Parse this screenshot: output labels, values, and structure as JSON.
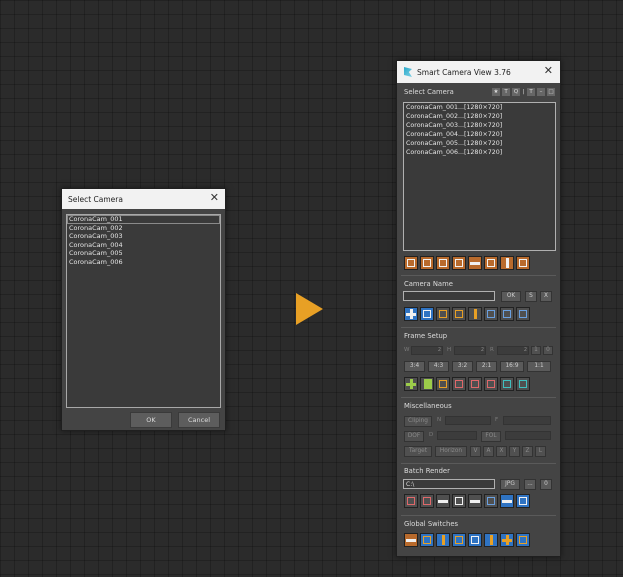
{
  "dialog": {
    "title": "Select Camera",
    "items": [
      "CoronaCam_001",
      "CoronaCam_002",
      "CoronaCam_003",
      "CoronaCam_004",
      "CoronaCam_005",
      "CoronaCam_006"
    ],
    "ok_label": "OK",
    "cancel_label": "Cancel"
  },
  "arrow_color": "#e8a025",
  "panel": {
    "title": "Smart Camera View 3.76",
    "select_camera_label": "Select Camera",
    "header_icons": [
      "pin-icon",
      "T",
      "Q",
      "|",
      "T",
      "–",
      "□"
    ],
    "cameras": [
      "CoronaCam_001...[1280×720]",
      "CoronaCam_002...[1280×720]",
      "CoronaCam_003...[1280×720]",
      "CoronaCam_004...[1280×720]",
      "CoronaCam_005...[1280×720]",
      "CoronaCam_006...[1280×720]"
    ],
    "camera_name_label": "Camera Name",
    "camera_name_value": "",
    "name_ok": "OK",
    "name_s": "S",
    "name_x": "X",
    "frame_setup_label": "Frame Setup",
    "w_label": "W",
    "h_label": "H",
    "r_label": "R",
    "w_value": "2",
    "h_value": "2",
    "r_value": "2",
    "ratio_1": "1",
    "ratio_0": "0",
    "ratios": [
      "3:4",
      "4:3",
      "3:2",
      "2:1",
      "16:9",
      "1:1"
    ],
    "misc_label": "Miscellaneous",
    "clipping": "Cliping",
    "n_label": "N",
    "f_label": "F",
    "dof": "DOF",
    "d_label": "D",
    "fol": "FOL",
    "target": "Target",
    "horizon": "Horizon",
    "axes": [
      "V",
      "A",
      "X",
      "Y",
      "Z",
      "L"
    ],
    "batch_label": "Batch Render",
    "batch_path": "C:\\",
    "batch_format": "JPG",
    "batch_more": "...",
    "batch_zero": "0",
    "global_label": "Global Switches",
    "accent_orange": "#b86a2c",
    "accent_blue": "#2f73c2"
  }
}
